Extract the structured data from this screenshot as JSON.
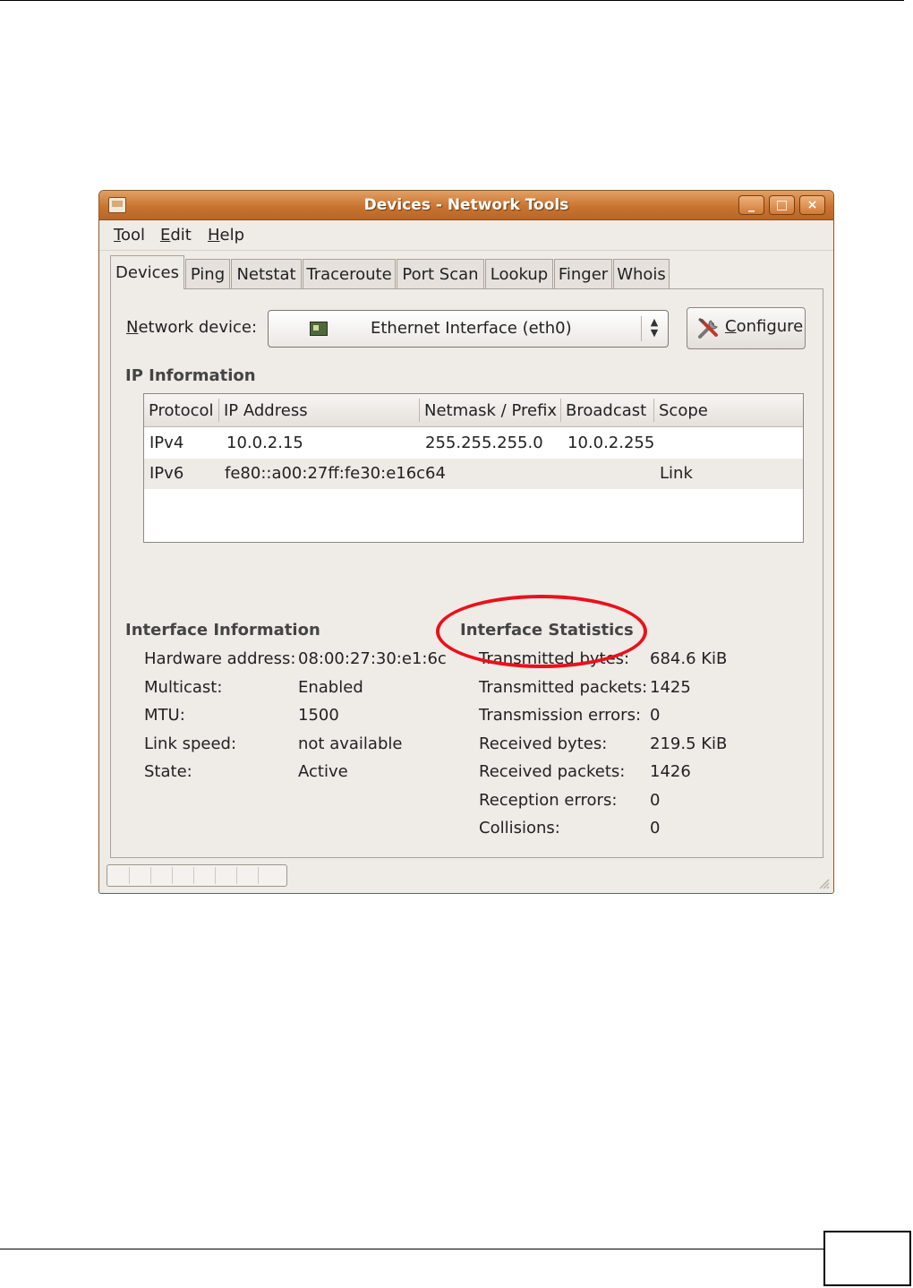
{
  "window": {
    "title": "Devices - Network Tools",
    "controls": {
      "minimize": "_",
      "maximize": "□",
      "close": "×"
    }
  },
  "menu": {
    "tool": "Tool",
    "edit": "Edit",
    "help": "Help"
  },
  "tabs": [
    "Devices",
    "Ping",
    "Netstat",
    "Traceroute",
    "Port Scan",
    "Lookup",
    "Finger",
    "Whois"
  ],
  "active_tab": "Devices",
  "device": {
    "label": "Network device:",
    "selected": "Ethernet Interface (eth0)",
    "icon": "network-card-icon",
    "configure_label": "Configure"
  },
  "ip_info": {
    "title": "IP Information",
    "columns": [
      "Protocol",
      "IP Address",
      "Netmask / Prefix",
      "Broadcast",
      "Scope"
    ],
    "rows": [
      {
        "protocol": "IPv4",
        "address": "10.0.2.15",
        "netmask": "255.255.255.0",
        "broadcast": "10.0.2.255",
        "scope": ""
      },
      {
        "protocol": "IPv6",
        "address": "fe80::a00:27ff:fe30:e16c",
        "netmask": "64",
        "broadcast": "",
        "scope": "Link"
      }
    ]
  },
  "interface_info": {
    "title": "Interface Information",
    "hardware_label": "Hardware address:",
    "hardware_value": "08:00:27:30:e1:6c",
    "multicast_label": "Multicast:",
    "multicast_value": "Enabled",
    "mtu_label": "MTU:",
    "mtu_value": "1500",
    "link_speed_label": "Link speed:",
    "link_speed_value": "not available",
    "state_label": "State:",
    "state_value": "Active"
  },
  "interface_stats": {
    "title": "Interface Statistics",
    "tx_bytes_label": "Transmitted bytes:",
    "tx_bytes_value": "684.6 KiB",
    "tx_packets_label": "Transmitted packets:",
    "tx_packets_value": "1425",
    "tx_errors_label": "Transmission errors:",
    "tx_errors_value": "0",
    "rx_bytes_label": "Received bytes:",
    "rx_bytes_value": "219.5 KiB",
    "rx_packets_label": "Received packets:",
    "rx_packets_value": "1426",
    "rx_errors_label": "Reception errors:",
    "rx_errors_value": "0",
    "collisions_label": "Collisions:",
    "collisions_value": "0"
  },
  "annotation": {
    "color": "#e8121b",
    "target": "Interface Statistics"
  },
  "colors": {
    "titlebar": "#c9742f",
    "window_bg": "#efebe7"
  }
}
